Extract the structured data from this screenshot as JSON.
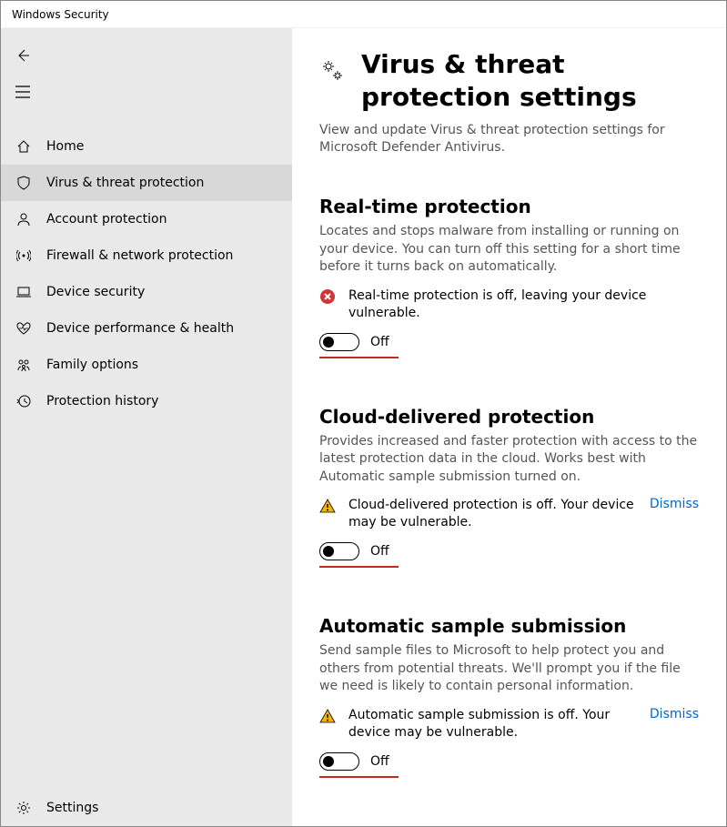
{
  "window": {
    "title": "Windows Security"
  },
  "sidebar": {
    "items": [
      {
        "label": "Home"
      },
      {
        "label": "Virus & threat protection"
      },
      {
        "label": "Account protection"
      },
      {
        "label": "Firewall & network protection"
      },
      {
        "label": "Device security"
      },
      {
        "label": "Device performance & health"
      },
      {
        "label": "Family options"
      },
      {
        "label": "Protection history"
      }
    ],
    "settings_label": "Settings"
  },
  "page": {
    "title": "Virus & threat protection settings",
    "description": "View and update Virus & threat protection settings for Microsoft Defender Antivirus."
  },
  "sections": {
    "realtime": {
      "title": "Real-time protection",
      "description": "Locates and stops malware from installing or running on your device. You can turn off this setting for a short time before it turns back on automatically.",
      "alert": "Real-time protection is off, leaving your device vulnerable.",
      "toggle_state": "Off"
    },
    "cloud": {
      "title": "Cloud-delivered protection",
      "description": "Provides increased and faster protection with access to the latest protection data in the cloud. Works best with Automatic sample submission turned on.",
      "alert": "Cloud-delivered protection is off. Your device may be vulnerable.",
      "dismiss": "Dismiss",
      "toggle_state": "Off"
    },
    "sample": {
      "title": "Automatic sample submission",
      "description": "Send sample files to Microsoft to help protect you and others from potential threats. We'll prompt you if the file we need is likely to contain personal information.",
      "alert": "Automatic sample submission is off. Your device may be vulnerable.",
      "dismiss": "Dismiss",
      "toggle_state": "Off"
    }
  }
}
